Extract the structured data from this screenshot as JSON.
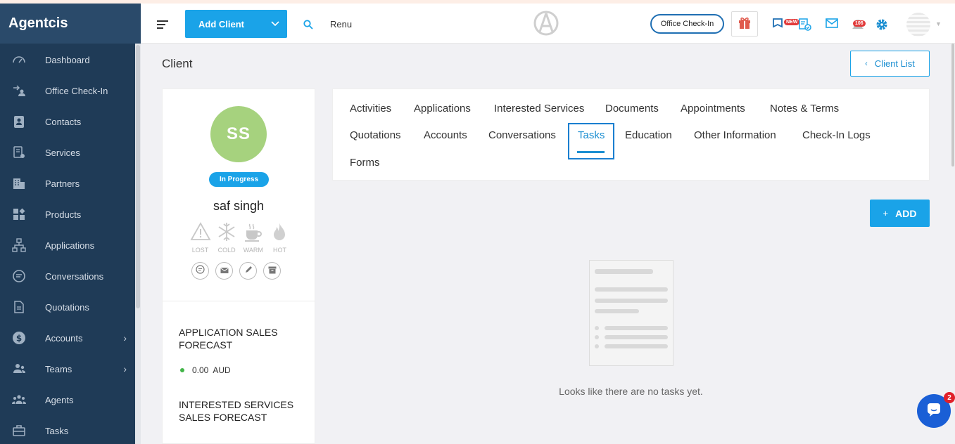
{
  "sidebar": {
    "brand": "Agentcis",
    "items": [
      {
        "label": "Dashboard",
        "icon": "gauge-icon"
      },
      {
        "label": "Office Check-In",
        "icon": "office-checkin-icon"
      },
      {
        "label": "Contacts",
        "icon": "contacts-icon"
      },
      {
        "label": "Services",
        "icon": "services-icon"
      },
      {
        "label": "Partners",
        "icon": "building-icon"
      },
      {
        "label": "Products",
        "icon": "products-icon"
      },
      {
        "label": "Applications",
        "icon": "applications-icon"
      },
      {
        "label": "Conversations",
        "icon": "chat-bubble-icon"
      },
      {
        "label": "Quotations",
        "icon": "quotation-icon"
      },
      {
        "label": "Accounts",
        "icon": "dollar-icon",
        "has_submenu": true
      },
      {
        "label": "Teams",
        "icon": "team-icon",
        "has_submenu": true
      },
      {
        "label": "Agents",
        "icon": "agents-icon"
      },
      {
        "label": "Tasks",
        "icon": "briefcase-icon"
      }
    ]
  },
  "header": {
    "add_client_label": "Add Client",
    "search_value": "Renu",
    "office_checkin_label": "Office Check-In",
    "new_badge": "NEW",
    "notification_count": "106"
  },
  "page": {
    "title": "Client",
    "client_list_label": "Client List"
  },
  "profile": {
    "initials": "SS",
    "status": "In Progress",
    "name": "saf singh",
    "temperatures": [
      "LOST",
      "COLD",
      "WARM",
      "HOT"
    ],
    "application_forecast_title": "APPLICATION SALES FORECAST",
    "application_forecast_value": "0.00",
    "application_forecast_currency": "AUD",
    "interested_forecast_title": "INTERESTED SERVICES SALES FORECAST"
  },
  "tabs": {
    "row1": [
      "Activities",
      "Applications",
      "Interested Services",
      "Documents",
      "Appointments",
      "Notes & Terms"
    ],
    "row2": [
      "Quotations",
      "Accounts",
      "Conversations",
      "Tasks",
      "Education",
      "Other Information",
      "Check-In Logs"
    ],
    "row3": [
      "Forms"
    ],
    "active": "Tasks"
  },
  "tasks": {
    "add_label": "ADD",
    "empty_message": "Looks like there are no tasks yet."
  },
  "chat": {
    "unread": "2"
  },
  "colors": {
    "sidebar": "#1f3b57",
    "primary": "#1aa3e8",
    "avatar": "#a6d27e"
  }
}
